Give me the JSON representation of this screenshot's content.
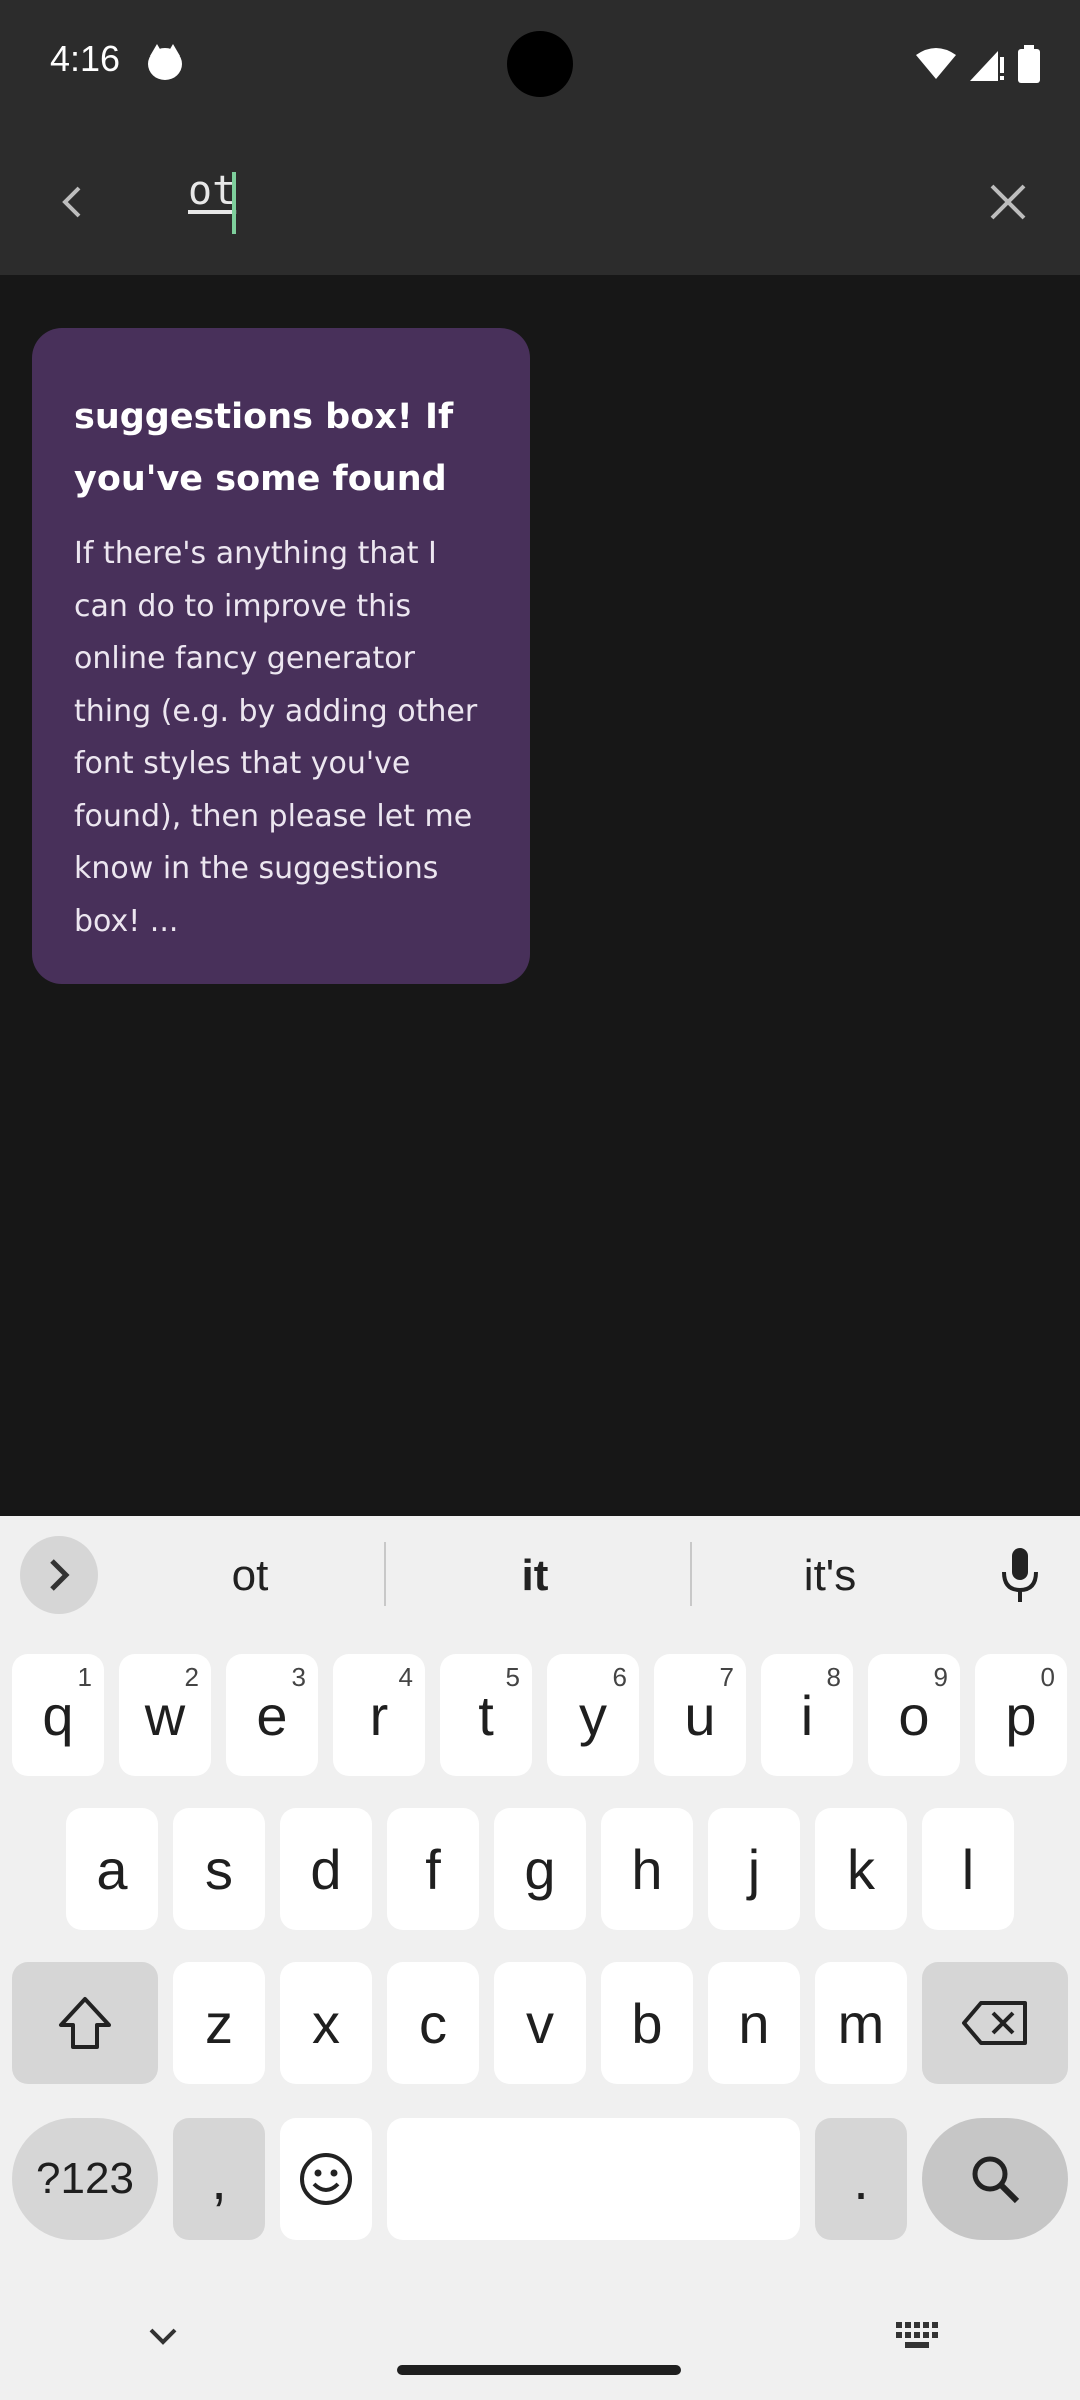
{
  "status_bar": {
    "time": "4:16"
  },
  "search": {
    "query": "ot"
  },
  "note": {
    "title": "suggestions box! If you've some found",
    "body": "If there's anything that I can do to improve this online fancy generator thing (e.g. by adding other font styles that you've found), then please let me know in the suggestions box! ..."
  },
  "keyboard": {
    "suggestions": [
      "ot",
      "it",
      "it's"
    ],
    "row1": [
      {
        "label": "q",
        "hint": "1"
      },
      {
        "label": "w",
        "hint": "2"
      },
      {
        "label": "e",
        "hint": "3"
      },
      {
        "label": "r",
        "hint": "4"
      },
      {
        "label": "t",
        "hint": "5"
      },
      {
        "label": "y",
        "hint": "6"
      },
      {
        "label": "u",
        "hint": "7"
      },
      {
        "label": "i",
        "hint": "8"
      },
      {
        "label": "o",
        "hint": "9"
      },
      {
        "label": "p",
        "hint": "0"
      }
    ],
    "row2": [
      "a",
      "s",
      "d",
      "f",
      "g",
      "h",
      "j",
      "k",
      "l"
    ],
    "row3": [
      "z",
      "x",
      "c",
      "v",
      "b",
      "n",
      "m"
    ],
    "symbols_label": "?123",
    "comma_label": ",",
    "period_label": "."
  },
  "colors": {
    "app_background": "#171717",
    "toolbar": "#2c2c2c",
    "note_card": "#48305a",
    "cursor": "#7ecf9c",
    "keyboard": "#f0f0f0"
  },
  "icons": [
    "back-arrow-icon",
    "close-icon",
    "chevron-right-icon",
    "microphone-icon",
    "shift-icon",
    "backspace-icon",
    "emoji-icon",
    "search-icon",
    "chevron-down-icon",
    "keyboard-icon",
    "wifi-icon",
    "signal-icon",
    "battery-icon"
  ]
}
